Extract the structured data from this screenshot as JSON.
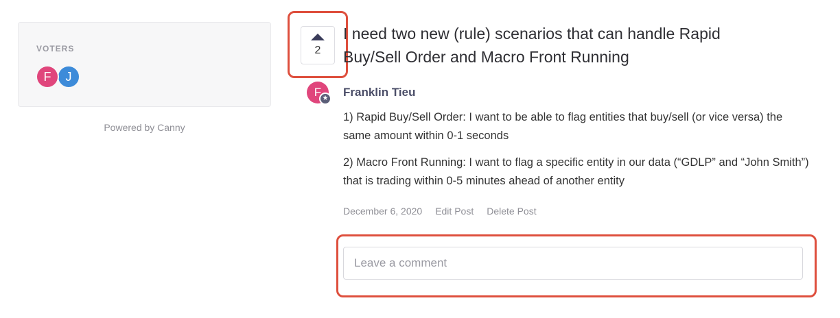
{
  "sidebar": {
    "voters_heading": "VOTERS",
    "voters": [
      {
        "initial": "F",
        "color": "#e0467c"
      },
      {
        "initial": "J",
        "color": "#3d8bd9"
      }
    ],
    "powered_by": "Powered by Canny"
  },
  "post": {
    "vote_count": "2",
    "title": "I need two new (rule) scenarios that can handle Rapid Buy/Sell Order and Macro Front Running",
    "author": {
      "initial": "F",
      "name": "Franklin Tieu",
      "badge_icon": "star-icon"
    },
    "body": [
      "1) Rapid Buy/Sell Order: I want to be able to flag entities that buy/sell (or vice versa) the same amount within 0-1 seconds",
      "2) Macro Front Running: I want to flag a specific entity in our data (“GDLP” and “John Smith”) that is trading within 0-5 minutes ahead of another entity"
    ],
    "date": "December 6, 2020",
    "edit_label": "Edit Post",
    "delete_label": "Delete Post"
  },
  "comment": {
    "placeholder": "Leave a comment"
  },
  "colors": {
    "highlight": "#de4f3d",
    "avatar_pink": "#e0467c",
    "avatar_blue": "#3d8bd9"
  }
}
